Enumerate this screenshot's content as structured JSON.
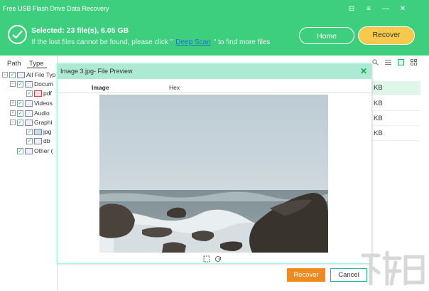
{
  "app": {
    "title": "Free USB Flash Drive Data Recovery",
    "controls": [
      "⊟",
      "≡",
      "—",
      "✕"
    ]
  },
  "header": {
    "selected": "Selected: 23 file(s), 6.05 GB",
    "hint_before": "If the lost files cannot be found, please click \"",
    "hint_link": "Deep Scan",
    "hint_after": "\" to find more files",
    "home_label": "Home",
    "recover_label": "Recover"
  },
  "left": {
    "tabs": [
      "Path",
      "Type"
    ],
    "tree": [
      {
        "label": "All File Typ"
      },
      {
        "label": "Docum"
      },
      {
        "label": "pdf"
      },
      {
        "label": "Videos"
      },
      {
        "label": "Audio"
      },
      {
        "label": "Graphi"
      },
      {
        "label": "jpg"
      },
      {
        "label": "db"
      },
      {
        "label": "Other ("
      }
    ]
  },
  "right": {
    "sizes": [
      "KB",
      "KB",
      "KB",
      "KB"
    ],
    "icons": [
      "search-icon",
      "list-icon",
      "grid-icon",
      "details-icon"
    ]
  },
  "preview": {
    "title": "Image 3.jpg- File Preview",
    "close": "✕",
    "col_image": "Image",
    "col_hex": "Hex",
    "tools": [
      "crop-icon",
      "rotate-icon"
    ]
  },
  "footer": {
    "recover_label": "Recover",
    "cancel_label": "Cancel"
  },
  "colors": {
    "brand_green": "#3ecf7e",
    "accent_yellow": "#f6c84c",
    "recover_orange": "#f08a1f",
    "preview_header": "#aee9d3"
  }
}
